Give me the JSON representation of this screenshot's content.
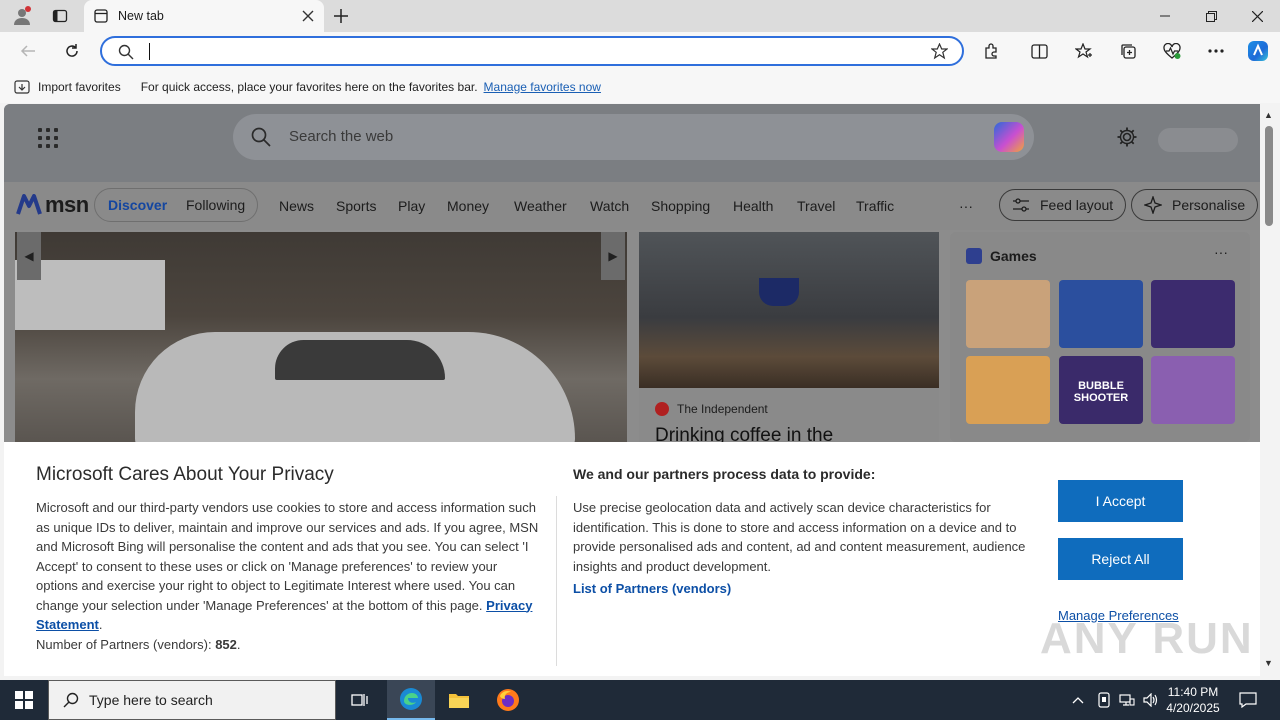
{
  "browser": {
    "tab_title": "New tab",
    "favorites_bar": {
      "import_label": "Import favorites",
      "hint": "For quick access, place your favorites here on the favorites bar.",
      "manage_link": "Manage favorites now"
    }
  },
  "msn": {
    "search_placeholder": "Search the web",
    "logo_text": "msn",
    "pills": [
      "Discover",
      "Following"
    ],
    "nav": [
      "News",
      "Sports",
      "Play",
      "Money",
      "Weather",
      "Watch",
      "Shopping",
      "Health",
      "Travel",
      "Traffic"
    ],
    "more_label": "···",
    "feed_layout_label": "Feed layout",
    "personalise_label": "Personalise",
    "article": {
      "source": "The Independent",
      "headline": "Drinking coffee in the"
    },
    "games": {
      "title": "Games",
      "more": "···",
      "tiles": [
        {
          "name": "game-tile-1",
          "color": "#c9a27a"
        },
        {
          "name": "game-tile-2",
          "color": "#2b4f9e"
        },
        {
          "name": "game-tile-3",
          "color": "#3c2b6e"
        },
        {
          "name": "game-tile-4",
          "color": "#d9a055"
        },
        {
          "name": "game-tile-5",
          "color": "#3a2a6a",
          "label": "BUBBLE SHOOTER"
        },
        {
          "name": "game-tile-6",
          "color": "#8a5fb0"
        }
      ]
    }
  },
  "privacy": {
    "title": "Microsoft Cares About Your Privacy",
    "body": "Microsoft and our third-party vendors use cookies to store and access information such as unique IDs to deliver, maintain and improve our services and ads. If you agree, MSN and Microsoft Bing will personalise the content and ads that you see. You can select 'I Accept' to consent to these uses or click on 'Manage preferences' to review your options and exercise your right to object to Legitimate Interest where used.  You can change your selection under 'Manage Preferences' at the bottom of this page.",
    "privacy_link": "Privacy Statement",
    "partners_label": "Number of Partners (vendors):",
    "partners_count": "852",
    "col2_title": "We and our partners process data to provide:",
    "col2_body": "Use precise geolocation data and actively scan device characteristics for identification. This is done to store and access information on a device and to provide personalised ads and content, ad and content measurement, audience insights and product development.",
    "partners_link": "List of Partners (vendors)",
    "accept": "I Accept",
    "reject": "Reject All",
    "manage": "Manage Preferences"
  },
  "watermark": "ANY RUN",
  "taskbar": {
    "search_placeholder": "Type here to search",
    "time": "11:40 PM",
    "date": "4/20/2025"
  },
  "colors": {
    "accent": "#0f6cbd",
    "link": "#0c4fa6",
    "address_focus": "#2f6fdc"
  }
}
